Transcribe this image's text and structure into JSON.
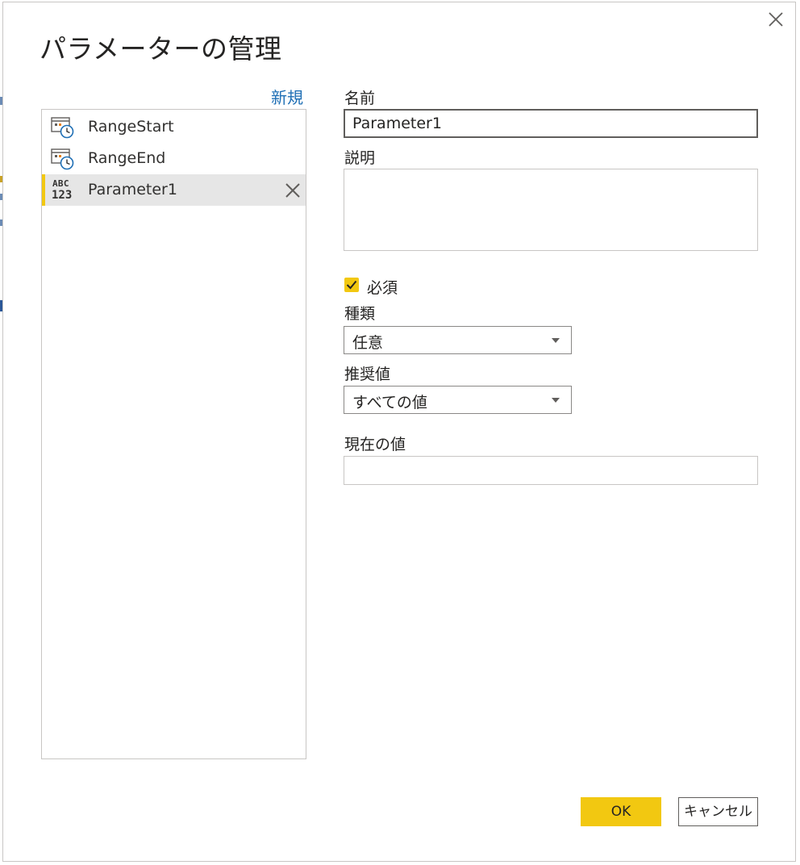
{
  "dialog": {
    "title": "パラメーターの管理",
    "close_icon": "close-icon"
  },
  "list": {
    "new_label": "新規",
    "items": [
      {
        "label": "RangeStart",
        "icon": "datetime-parameter-icon",
        "selected": false
      },
      {
        "label": "RangeEnd",
        "icon": "datetime-parameter-icon",
        "selected": false
      },
      {
        "label": "Parameter1",
        "icon": "any-type-abc123-icon",
        "selected": true,
        "icon_text_top": "ABC",
        "icon_text_bottom": "123"
      }
    ]
  },
  "form": {
    "name_label": "名前",
    "name_value": "Parameter1",
    "description_label": "説明",
    "description_value": "",
    "required_label": "必須",
    "required_checked": true,
    "type_label": "種類",
    "type_value": "任意",
    "suggested_label": "推奨値",
    "suggested_value": "すべての値",
    "current_label": "現在の値",
    "current_value": ""
  },
  "footer": {
    "ok_label": "OK",
    "cancel_label": "キャンセル"
  },
  "colors": {
    "accent": "#f2c811",
    "link": "#1f6fb5",
    "selected_row": "#e6e6e6"
  }
}
